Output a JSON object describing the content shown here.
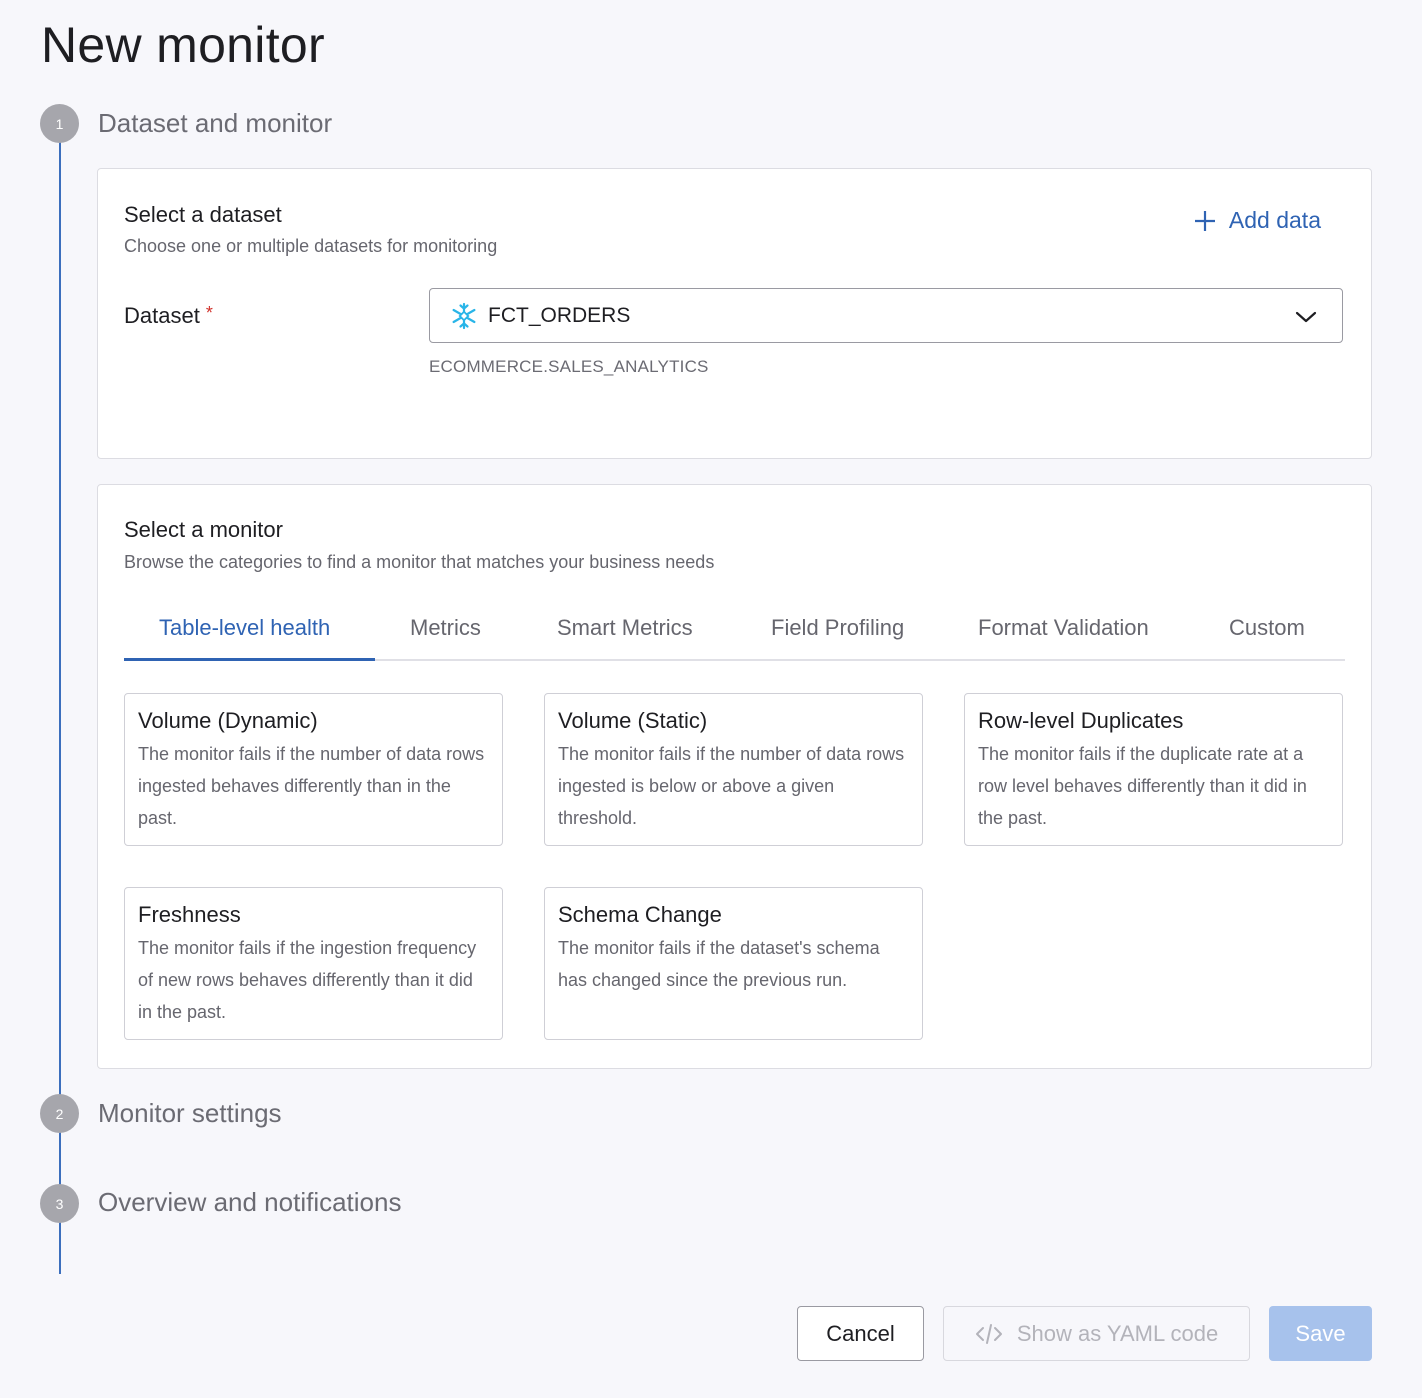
{
  "page": {
    "title": "New monitor"
  },
  "steps": [
    {
      "number": "1",
      "title": "Dataset and monitor"
    },
    {
      "number": "2",
      "title": "Monitor settings"
    },
    {
      "number": "3",
      "title": "Overview and notifications"
    }
  ],
  "dataset_section": {
    "title": "Select a dataset",
    "subtitle": "Choose one or multiple datasets for monitoring",
    "add_data_label": "Add data",
    "field_label": "Dataset",
    "required_mark": "*",
    "selected_value": "FCT_ORDERS",
    "selected_icon": "snowflake-icon",
    "path": "ECOMMERCE.SALES_ANALYTICS"
  },
  "monitor_section": {
    "title": "Select a monitor",
    "subtitle": "Browse the categories to find a monitor that matches your business needs",
    "tabs": [
      {
        "label": "Table-level health",
        "active": true
      },
      {
        "label": "Metrics"
      },
      {
        "label": "Smart Metrics"
      },
      {
        "label": "Field Profiling"
      },
      {
        "label": "Format Validation"
      },
      {
        "label": "Custom"
      }
    ],
    "monitors": [
      {
        "title": "Volume (Dynamic)",
        "description": "The monitor fails if the number of data rows ingested behaves differently than in the past."
      },
      {
        "title": "Volume (Static)",
        "description": "The monitor fails if the number of data rows ingested is below or above a given threshold."
      },
      {
        "title": "Row-level Duplicates",
        "description": "The monitor fails if the duplicate rate at a row level behaves differently than it did in the past."
      },
      {
        "title": "Freshness",
        "description": "The monitor fails if the ingestion frequency of new rows behaves differently than it did in the past."
      },
      {
        "title": "Schema Change",
        "description": "The monitor fails if the dataset's schema has changed since the previous run."
      }
    ]
  },
  "footer": {
    "cancel_label": "Cancel",
    "yaml_label": "Show as YAML code",
    "save_label": "Save"
  },
  "colors": {
    "accent": "#2f63b3",
    "save_disabled": "#a7c2ec",
    "snowflake": "#29b5e8",
    "required": "#d0302a"
  }
}
